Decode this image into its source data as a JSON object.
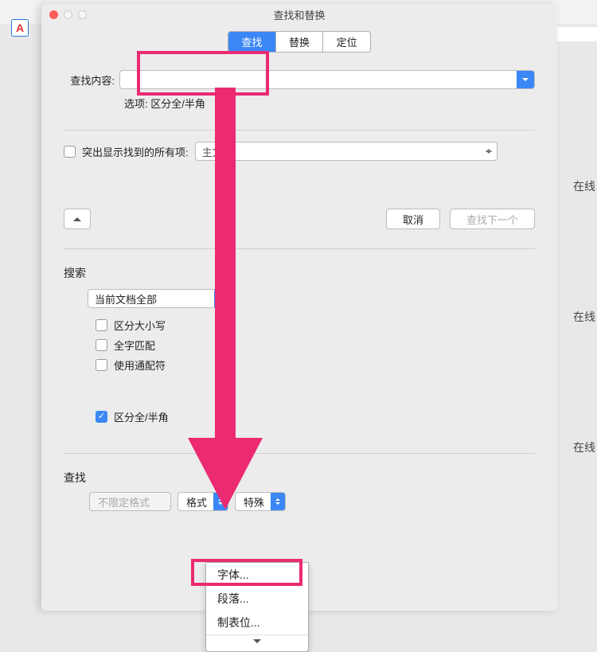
{
  "dialog": {
    "title": "查找和替换",
    "tabs": {
      "find": "查找",
      "replace": "替换",
      "goto": "定位"
    },
    "find_label": "查找内容:",
    "options_label": "选项:",
    "options_value": "区分全/半角",
    "highlight_label": "突出显示找到的所有项:",
    "highlight_scope": "主文档",
    "cancel": "取消",
    "find_next": "查找下一个",
    "search_header": "搜索",
    "search_scope": "当前文档全部",
    "checks": {
      "case": "区分大小写",
      "whole": "全字匹配",
      "wildcard": "使用通配符",
      "fullhalf": "区分全/半角"
    },
    "find_header": "查找",
    "no_format": "不限定格式",
    "format": "格式",
    "special": "特殊"
  },
  "menu": {
    "font": "字体...",
    "paragraph": "段落...",
    "tabs": "制表位..."
  },
  "side": {
    "s1": "在线",
    "s2": "在线",
    "s3": "在线"
  },
  "icon_a": "A"
}
